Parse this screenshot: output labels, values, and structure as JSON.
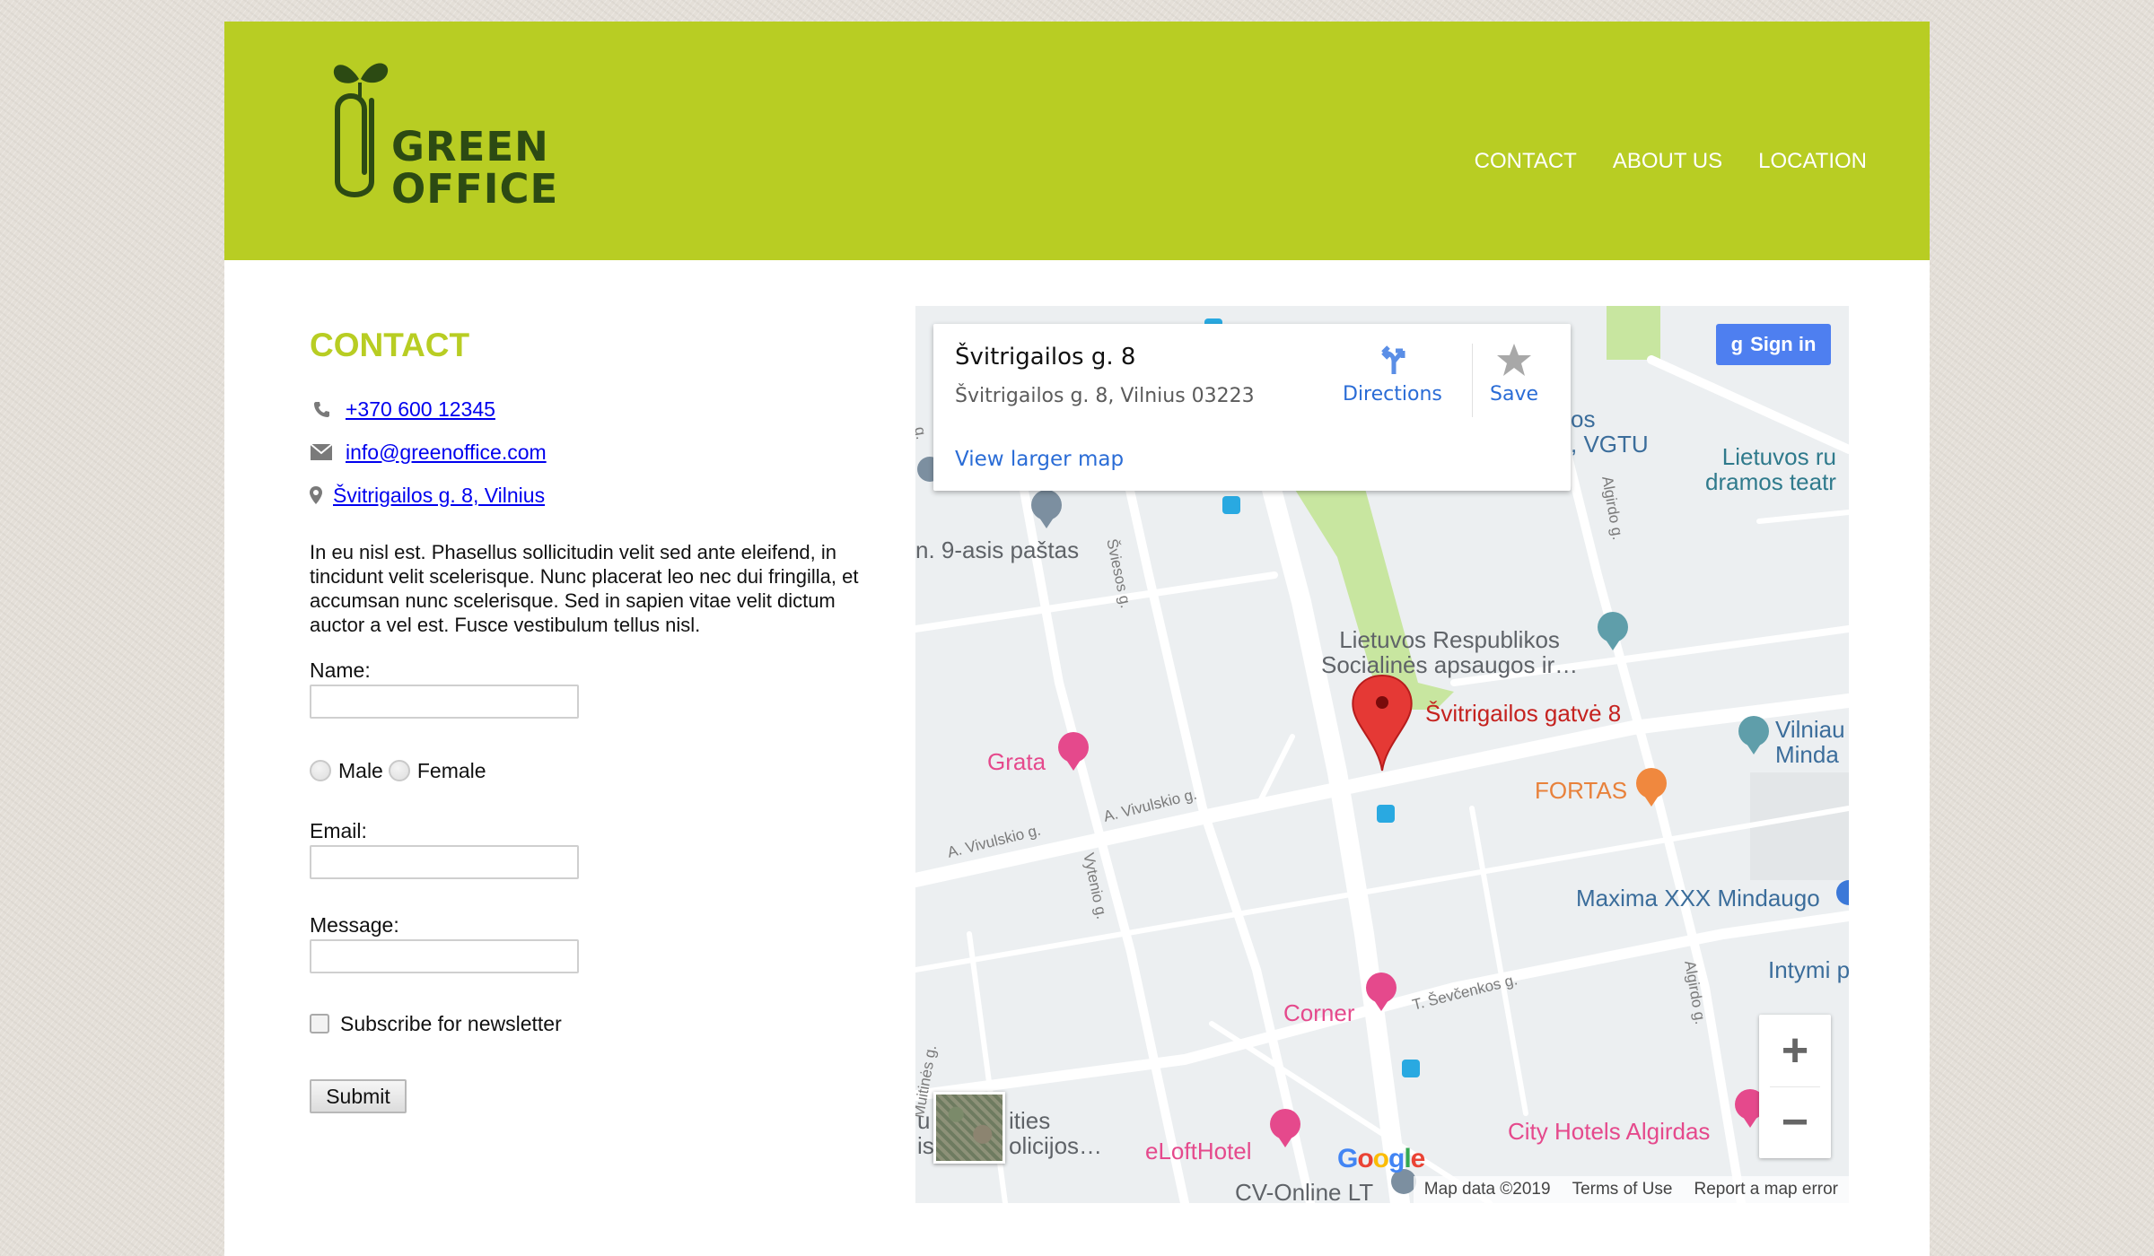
{
  "header": {
    "logo_text_line1": "GREEN",
    "logo_text_line2": "OFFICE",
    "nav": [
      "CONTACT",
      "ABOUT US",
      "LOCATION"
    ]
  },
  "contact": {
    "title": "CONTACT",
    "phone": "+370 600 12345",
    "email": "info@greenoffice.com",
    "address": "Švitrigailos g. 8, Vilnius",
    "description": "In eu nisl est. Phasellus sollicitudin velit sed ante eleifend, in tincidunt velit scelerisque. Nunc placerat leo nec dui fringilla, et accumsan nunc scelerisque. Sed in sapien vitae velit dictum auctor a vel est. Fusce vestibulum tellus nisl."
  },
  "form": {
    "name_label": "Name:",
    "male_label": "Male",
    "female_label": "Female",
    "email_label": "Email:",
    "message_label": "Message:",
    "subscribe_label": "Subscribe for newsletter",
    "submit_label": "Submit"
  },
  "map": {
    "card_title": "Švitrigailos g. 8",
    "card_address": "Švitrigailos g. 8, Vilnius 03223",
    "directions_label": "Directions",
    "save_label": "Save",
    "view_larger": "View larger map",
    "signin_label": "Sign in",
    "pin_label": "Švitrigailos gatvė 8",
    "pois": {
      "vgtu_line1": "os",
      "vgtu_line2": ", VGTU",
      "theatre_line1": "Lietuvos ru",
      "theatre_line2": "dramos teatr",
      "post": "n. 9-asis paštas",
      "ministry_line1": "Lietuvos Respublikos",
      "ministry_line2": "Socialinės apsaugos ir…",
      "grata": "Grata",
      "fortas": "FORTAS",
      "vilniaus_line1": "Vilniau",
      "vilniaus_line2": "Minda",
      "maxima": "Maxima XXX Mindaugo",
      "intymi": "Intymi p",
      "corner": "Corner",
      "city_line1": "ities",
      "city_line2": "olicijos…",
      "city_prefix1": "u",
      "city_prefix2": "is",
      "eloft": "eLoftHotel",
      "city_hotels": "City Hotels Algirdas",
      "cvonline": "CV-Online LT"
    },
    "streets": {
      "sviesos": "Šviesos g.",
      "algirdo": "Algirdo g.",
      "vivulskio1": "A. Vivulskio g.",
      "vivulskio2": "A. Vivulskio g.",
      "vytenio": "Vytenio g.",
      "sevcenkos": "T. Ševčenkos g.",
      "algirdo2": "Algirdo g.",
      "muitines": "Muitinės g.",
      "left_g": "g."
    },
    "google": "Google",
    "attrib_data": "Map data ©2019",
    "attrib_terms": "Terms of Use",
    "attrib_report": "Report a map error",
    "colors": {
      "pin": "#e53935",
      "pink": "#e5498c",
      "blue": "#3b6d9b",
      "park": "#c8e6a0"
    }
  }
}
